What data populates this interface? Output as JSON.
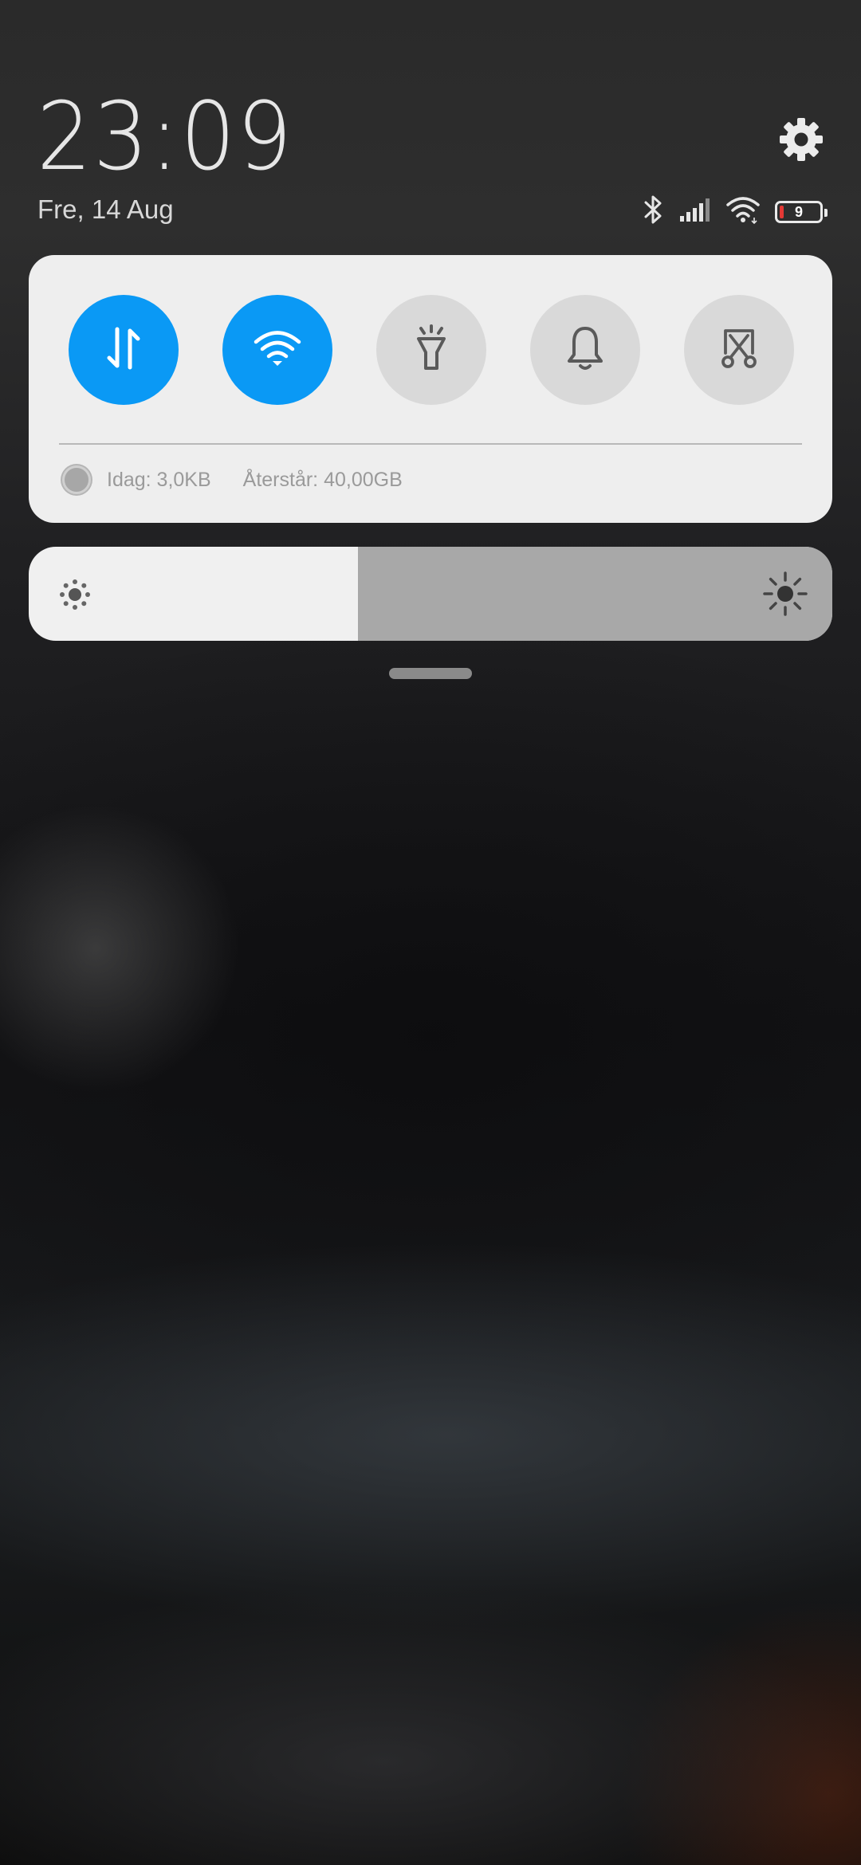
{
  "header": {
    "time": "23:09",
    "date": "Fre, 14 Aug"
  },
  "status_bar": {
    "icons": [
      "bluetooth-icon",
      "cellular-signal-icon",
      "wifi-icon",
      "battery-icon"
    ],
    "battery_level": "9",
    "battery_low_color": "#e53935"
  },
  "quick_settings": {
    "toggles": [
      {
        "name": "mobile-data",
        "icon": "data-arrows-icon",
        "state": "on"
      },
      {
        "name": "wifi",
        "icon": "wifi-icon",
        "state": "on"
      },
      {
        "name": "flashlight",
        "icon": "flashlight-icon",
        "state": "off"
      },
      {
        "name": "sound",
        "icon": "bell-icon",
        "state": "off"
      },
      {
        "name": "screenshot",
        "icon": "scissors-screenshot-icon",
        "state": "off"
      }
    ],
    "active_color": "#0a99f5",
    "inactive_color": "#d9d9d9"
  },
  "data_usage": {
    "today": "Idag: 3,0KB",
    "remaining": "Återstår: 40,00GB"
  },
  "brightness": {
    "level_fraction": 0.41,
    "icons": [
      "brightness-low-icon",
      "brightness-high-icon"
    ]
  }
}
